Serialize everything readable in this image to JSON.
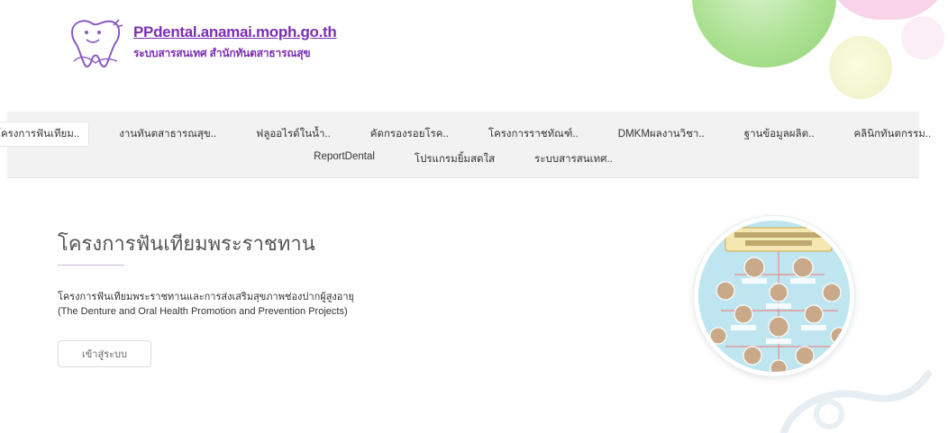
{
  "header": {
    "site_name": "PPdental.anamai.moph.go.th",
    "site_subtitle": "ระบบสารสนเทศ สำนักทันตสาธารณสุข"
  },
  "nav": {
    "row1": [
      {
        "label": "โครงการฟันเทียม..",
        "active": true
      },
      {
        "label": "งานทันตสาธารณสุข..",
        "active": false
      },
      {
        "label": "ฟลูออไรด์ในน้ำ..",
        "active": false
      },
      {
        "label": "คัดกรองรอยโรค..",
        "active": false
      },
      {
        "label": "โครงการราชทัณฑ์..",
        "active": false
      },
      {
        "label": "DMKMผลงานวิชา..",
        "active": false
      },
      {
        "label": "ฐานข้อมูลผลิต..",
        "active": false
      },
      {
        "label": "คลินิกทันตกรรม..",
        "active": false
      }
    ],
    "row2": [
      {
        "label": "ReportDental",
        "active": false
      },
      {
        "label": "โปรแกรมยิ้มสดใส",
        "active": false
      },
      {
        "label": "ระบบสารสนเทศ..",
        "active": false
      }
    ]
  },
  "main": {
    "title": "โครงการฟันเทียมพระราชทาน",
    "description_th": "โครงการฟันเทียมพระราชทานและการส่งเสริมสุขภาพช่องปากผู้สูงอายุ",
    "description_en": "(The Denture and Oral Health Promotion and Prevention Projects)",
    "enter_button": "เข้าสู่ระบบ"
  },
  "colors": {
    "brand_purple": "#7b2fb0",
    "nav_bg": "#f2f2f2",
    "image_bg": "#bfe6f0"
  }
}
